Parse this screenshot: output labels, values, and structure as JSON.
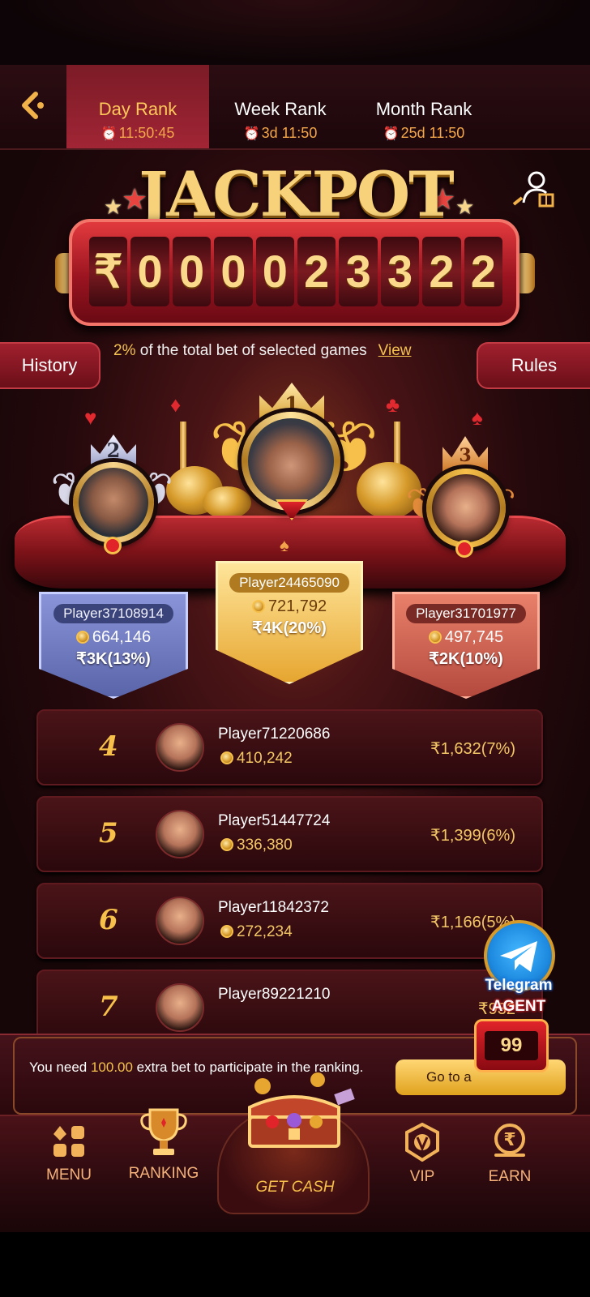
{
  "header": {
    "back_icon": "back-chevron-icon",
    "tabs": [
      {
        "label": "Day Rank",
        "time": "11:50:45",
        "active": true
      },
      {
        "label": "Week Rank",
        "time": "3d 11:50",
        "active": false
      },
      {
        "label": "Month Rank",
        "time": "25d 11:50",
        "active": false
      }
    ]
  },
  "jackpot": {
    "title": "JACKPOT",
    "currency": "₹",
    "digits": [
      "0",
      "0",
      "0",
      "0",
      "2",
      "3",
      "3",
      "2",
      "2"
    ],
    "description": {
      "percent": "2%",
      "text": " of the total bet of selected games",
      "link": "View"
    },
    "history_label": "History",
    "rules_label": "Rules"
  },
  "podium": [
    {
      "rank": "1",
      "name": "Player24465090",
      "coins": "721,792",
      "prize": "₹4K(20%)"
    },
    {
      "rank": "2",
      "name": "Player37108914",
      "coins": "664,146",
      "prize": "₹3K(13%)"
    },
    {
      "rank": "3",
      "name": "Player31701977",
      "coins": "497,745",
      "prize": "₹2K(10%)"
    }
  ],
  "ranking_list": [
    {
      "rank": "4",
      "name": "Player71220686",
      "coins": "410,242",
      "prize": "₹1,632(7%)"
    },
    {
      "rank": "5",
      "name": "Player51447724",
      "coins": "336,380",
      "prize": "₹1,399(6%)"
    },
    {
      "rank": "6",
      "name": "Player11842372",
      "coins": "272,234",
      "prize": "₹1,166(5%)"
    },
    {
      "rank": "7",
      "name": "Player89221210",
      "coins": "",
      "prize": "₹932"
    }
  ],
  "banner": {
    "text_before": "You need ",
    "amount": "100.00",
    "text_after": " extra bet to participate in the ranking.",
    "button": "Go to a"
  },
  "floating": {
    "telegram_label": "Telegram",
    "agent_label": "AGENT",
    "slot_value": "99"
  },
  "nav": {
    "menu": "MENU",
    "ranking": "RANKING",
    "get_cash": "GET CASH",
    "vip": "VIP",
    "earn": "EARN"
  },
  "colors": {
    "accent_gold": "#f6c04a",
    "tab_active": "#a12535",
    "background": "#120608"
  }
}
